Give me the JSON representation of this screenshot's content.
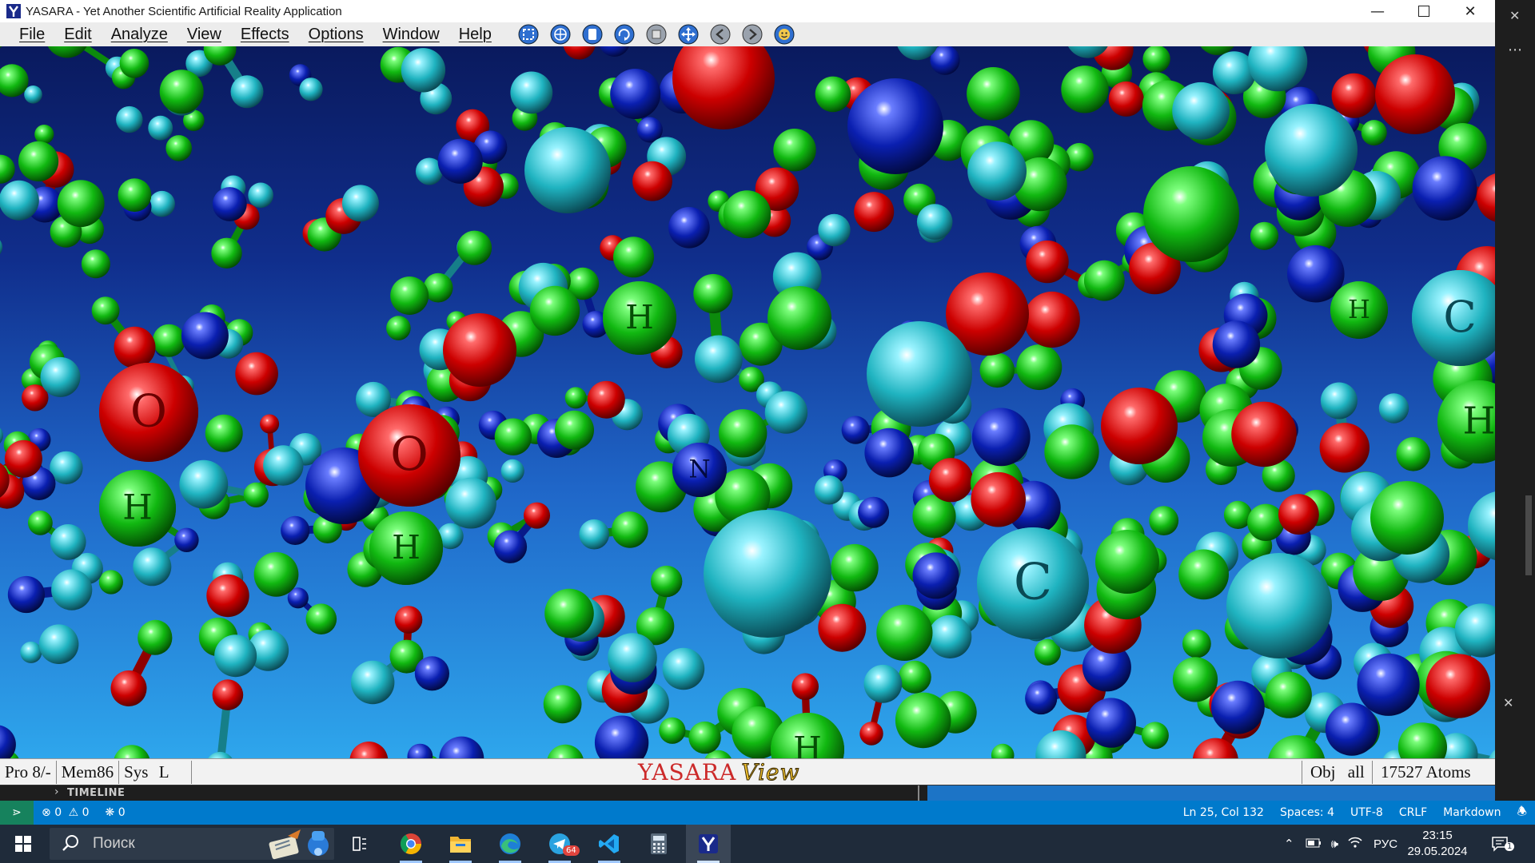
{
  "window": {
    "title": "YASARA - Yet Another Scientific Artificial Reality Application",
    "controls": [
      "minimize",
      "maximize",
      "close"
    ]
  },
  "menu": {
    "items": [
      "File",
      "Edit",
      "Analyze",
      "View",
      "Effects",
      "Options",
      "Window",
      "Help"
    ],
    "toolbar_icons": [
      "select-icon",
      "globe-icon",
      "document-icon",
      "rotate-icon",
      "save-icon",
      "center-icon",
      "rewind-icon",
      "forward-icon",
      "mood-icon"
    ]
  },
  "scene": {
    "atom_labels": {
      "o1": "O",
      "o2": "O",
      "h1": "H",
      "h2": "H",
      "h3": "H",
      "h4": "H",
      "h5": "H",
      "h6": "H",
      "c1": "C",
      "c2": "C",
      "n1": "N"
    },
    "element_colors": {
      "oxygen": "#cc0000",
      "hydrogen": "#11b811",
      "carbon": "#1fb3c0",
      "nitrogen": "#0a1fb0"
    }
  },
  "statusbar": {
    "pro": "Pro 8/-",
    "mem": "Mem86",
    "sys": "Sys",
    "sys_flag": "L",
    "brand_main": "YASARA",
    "brand_sub": "View",
    "obj": "Obj",
    "obj_value": "all",
    "atoms": "17527 Atoms"
  },
  "vscode": {
    "panel_title": "TIMELINE",
    "errors": "0",
    "warnings": "0",
    "ports": "0",
    "position": "Ln 25, Col 132",
    "spaces": "Spaces: 4",
    "encoding": "UTF-8",
    "eol": "CRLF",
    "language": "Markdown"
  },
  "taskbar": {
    "search_placeholder": "Поиск",
    "apps": [
      "task-view-icon",
      "chrome-icon",
      "file-explorer-icon",
      "edge-icon",
      "telegram-icon",
      "vscode-icon",
      "calculator-icon",
      "yasara-icon"
    ],
    "telegram_badge": "64",
    "language": "РУС",
    "time": "23:15",
    "date": "29.05.2024"
  }
}
